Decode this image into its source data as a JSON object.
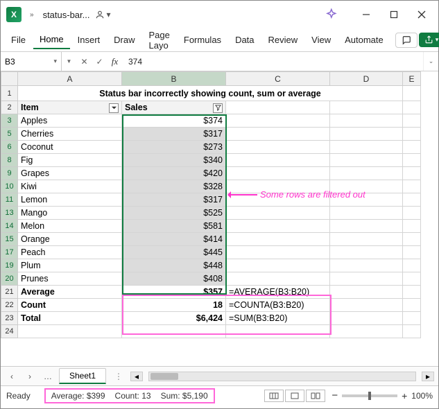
{
  "title": {
    "filename": "status-bar..."
  },
  "ribbon": {
    "tabs": [
      "File",
      "Home",
      "Insert",
      "Draw",
      "Page Layo",
      "Formulas",
      "Data",
      "Review",
      "View",
      "Automate"
    ],
    "active": "Home"
  },
  "formula": {
    "namebox": "B3",
    "value": "374"
  },
  "colheads": [
    "A",
    "B",
    "C",
    "D",
    "E"
  ],
  "row1_title": "Status bar incorrectly showing count, sum or average",
  "headers": {
    "item": "Item",
    "sales": "Sales"
  },
  "rows": [
    {
      "n": "3",
      "item": "Apples",
      "sales": "$374"
    },
    {
      "n": "5",
      "item": "Cherries",
      "sales": "$317"
    },
    {
      "n": "6",
      "item": "Coconut",
      "sales": "$273"
    },
    {
      "n": "8",
      "item": "Fig",
      "sales": "$340"
    },
    {
      "n": "9",
      "item": "Grapes",
      "sales": "$420"
    },
    {
      "n": "10",
      "item": "Kiwi",
      "sales": "$328"
    },
    {
      "n": "11",
      "item": "Lemon",
      "sales": "$317"
    },
    {
      "n": "13",
      "item": "Mango",
      "sales": "$525"
    },
    {
      "n": "14",
      "item": "Melon",
      "sales": "$581"
    },
    {
      "n": "15",
      "item": "Orange",
      "sales": "$414"
    },
    {
      "n": "17",
      "item": "Peach",
      "sales": "$445"
    },
    {
      "n": "19",
      "item": "Plum",
      "sales": "$448"
    },
    {
      "n": "20",
      "item": "Prunes",
      "sales": "$408"
    }
  ],
  "summary": [
    {
      "n": "21",
      "label": "Average",
      "val": "$357",
      "formula": "=AVERAGE(B3:B20)"
    },
    {
      "n": "22",
      "label": "Count",
      "val": "18",
      "formula": "=COUNTA(B3:B20)"
    },
    {
      "n": "23",
      "label": "Total",
      "val": "$6,424",
      "formula": "=SUM(B3:B20)"
    }
  ],
  "blankrow": "24",
  "annotation": "Some rows are filtered out",
  "sheet_tab": "Sheet1",
  "statusbar": {
    "ready": "Ready",
    "avg": "Average: $399",
    "count": "Count: 13",
    "sum": "Sum: $5,190",
    "zoom": "100%"
  }
}
